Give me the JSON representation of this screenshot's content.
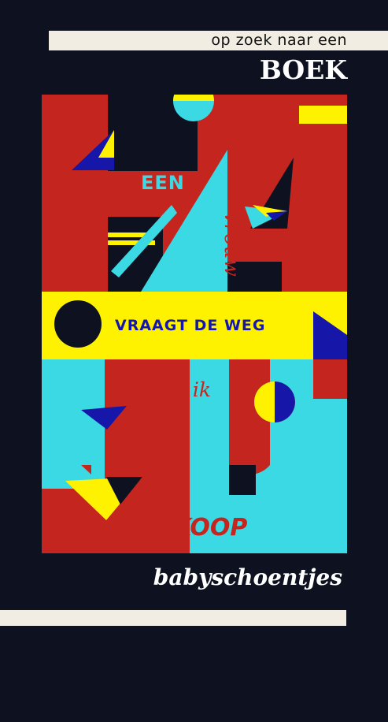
{
  "header": {
    "subtitle": "op zoek naar een",
    "title": "BOEK"
  },
  "poster": {
    "word_een": "EEN",
    "word_vrouw": "vrouw",
    "word_vraagt": "VRAAGT DE WEG",
    "word_enik": "en ik",
    "word_koop": "KOOP"
  },
  "footer": {
    "text": "babyschoentjes"
  },
  "colors": {
    "background": "#0e1220",
    "red": "#c4261f",
    "cyan": "#3ad9e3",
    "yellow": "#fff200",
    "blue": "#1616a8",
    "cream": "#f2ede3"
  }
}
